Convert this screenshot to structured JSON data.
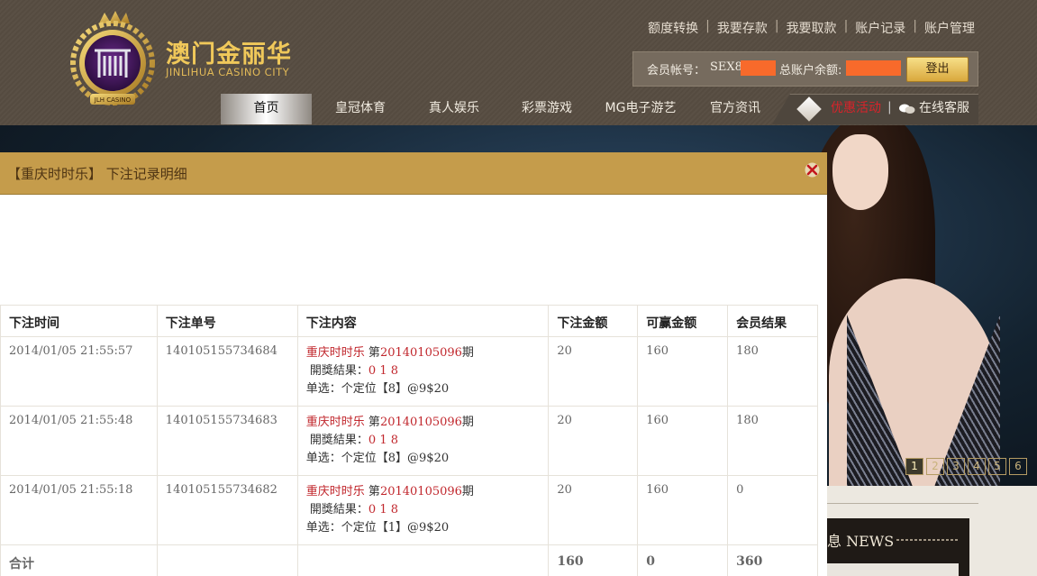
{
  "header": {
    "logo_cn": "澳门金丽华",
    "logo_en": "JINLIHUA  CASINO CITY",
    "logo_badge": "JLH CASINO",
    "top_links": [
      "额度转换",
      "我要存款",
      "我要取款",
      "账户记录",
      "账户管理"
    ],
    "account": {
      "id_label": "会员帐号：",
      "id_value": "SEX8",
      "balance_label": "总账户余额:",
      "login_button": "登出"
    }
  },
  "nav": {
    "items": [
      "首页",
      "皇冠体育",
      "真人娱乐",
      "彩票游戏",
      "MG电子游艺",
      "官方资讯"
    ],
    "promo": "优惠活动",
    "separator": "|",
    "service": "在线客服"
  },
  "banner": {
    "slides": [
      "1",
      "2",
      "3",
      "4",
      "5",
      "6"
    ],
    "active_slide": 1
  },
  "news": {
    "title": "息 NEWS"
  },
  "modal": {
    "title": "【重庆时时乐】 下注记录明细",
    "columns": [
      "下注时间",
      "下注单号",
      "下注内容",
      "下注金额",
      "可赢金额",
      "会员结果"
    ],
    "rows": [
      {
        "time": "2014/01/05 21:55:57",
        "order_no": "140105155734684",
        "game": "重庆时时乐",
        "period_prefix": "第",
        "period": "20140105096",
        "period_suffix": "期",
        "draw_label": "開獎結果：",
        "draw_result": "0 1 8",
        "bet_detail": "单选：个定位【8】@9$20",
        "amount": "20",
        "win_amount": "160",
        "result": "180"
      },
      {
        "time": "2014/01/05 21:55:48",
        "order_no": "140105155734683",
        "game": "重庆时时乐",
        "period_prefix": "第",
        "period": "20140105096",
        "period_suffix": "期",
        "draw_label": "開獎結果：",
        "draw_result": "0 1 8",
        "bet_detail": "单选：个定位【8】@9$20",
        "amount": "20",
        "win_amount": "160",
        "result": "180"
      },
      {
        "time": "2014/01/05 21:55:18",
        "order_no": "140105155734682",
        "game": "重庆时时乐",
        "period_prefix": "第",
        "period": "20140105096",
        "period_suffix": "期",
        "draw_label": "開獎結果：",
        "draw_result": "0 1 8",
        "bet_detail": "单选：个定位【1】@9$20",
        "amount": "20",
        "win_amount": "160",
        "result": "0"
      }
    ],
    "total": {
      "label": "合计",
      "amount": "160",
      "win_amount": "0",
      "result": "360"
    }
  },
  "colors": {
    "header_bg": "#554b40",
    "modal_header": "#c59c4b",
    "accent_red": "#c1272d",
    "total_orange": "#d35a14",
    "redaction": "#f86a2b"
  }
}
